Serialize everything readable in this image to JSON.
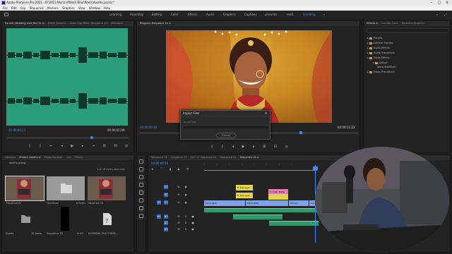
{
  "window": {
    "title": "Adobe Premiere Pro 2021 - D:\\2023 World AffAtch Bhai\\Reels\\Aastha.prproj *",
    "controls": [
      "–",
      "□",
      "×"
    ]
  },
  "menu": [
    "File",
    "Edit",
    "Clip",
    "Sequence",
    "Markers",
    "Graphics",
    "View",
    "Window",
    "Help"
  ],
  "workspaces": {
    "items": [
      "Learning",
      "Assembly",
      "Editing",
      "Color",
      "Effects",
      "Audio",
      "Graphics",
      "Captions",
      "Libraries",
      "reels",
      "Wedding",
      "»"
    ],
    "active": "Wedding"
  },
  "audio_source": {
    "tabs": [
      "Source: Wedding Cine Rec 11 ≡",
      "Effect Controls",
      "Audio Clip Mixer: Sequence 10",
      "Metadata"
    ],
    "timecode_in": "00:00:00:11",
    "timecode_out": "00:00:01:09",
    "color": "#2b9d78"
  },
  "program": {
    "tab": "Program: Sequence 10 ≡",
    "timecode": "00:00:00:16",
    "duration": "00:00:11:23",
    "fit": "Full"
  },
  "import_dialog": {
    "title": "Import Files",
    "status": "Importing...",
    "cancel_label": "Cancel"
  },
  "effects": {
    "tabs": [
      "Effects ≡",
      "Lumetri Color",
      "Essential Graphics"
    ],
    "items": [
      {
        "label": "Presets",
        "indent": 0
      },
      {
        "label": "Lumetri Presets",
        "indent": 0
      },
      {
        "label": "Audio Effects",
        "indent": 0
      },
      {
        "label": "Audio Transitions",
        "indent": 0
      },
      {
        "label": "Video Effects",
        "indent": 0
      },
      {
        "label": "Distort",
        "indent": 1
      },
      {
        "label": "Warp Stabilizer",
        "indent": 2
      },
      {
        "label": "Video Transitions",
        "indent": 0
      }
    ]
  },
  "project": {
    "tabs": [
      "Libraries",
      "Project: Aastha ≡",
      "Media Browser",
      "Info",
      "Effects"
    ],
    "file": "aastha.prproj",
    "selection": "1 of 16 items selected",
    "bins": [
      {
        "name": "Transition 01",
        "meta": "",
        "type": "video"
      },
      {
        "name": "Transition",
        "meta": "6 items",
        "type": "folder"
      },
      {
        "name": "Transition 01",
        "meta": "",
        "type": "video"
      },
      {
        "name": "Assets",
        "meta": "12 items",
        "type": "folder"
      },
      {
        "name": "Sequence 10",
        "meta": "10:11",
        "type": "sequence"
      },
      {
        "name": "10000000_994574558...",
        "meta": "",
        "type": "missing"
      }
    ]
  },
  "timeline": {
    "tabs": [
      "Sequence 01",
      "Sequence 07",
      "DST 07 Sequence 01",
      "Sequence 01",
      "Sequence 10 ≡"
    ],
    "timecode": "00:00:00:16",
    "video_tracks": [
      "V3",
      "V2",
      "V1"
    ],
    "audio_tracks": [
      "A1",
      "A2",
      "A3"
    ],
    "clips": {
      "v3": "fx Adj Layer",
      "v2a": "fx Adj Layer",
      "v2b": "fx Color Matte",
      "v1a": "DSC01644",
      "v1b": "DSC01684",
      "v1c": "DSC01...",
      "v1d": "DSC01731"
    }
  },
  "tools": [
    "selection-icon",
    "track-select-icon",
    "ripple-edit-icon",
    "razor-icon",
    "slip-icon",
    "pen-icon",
    "hand-icon",
    "type-icon"
  ]
}
